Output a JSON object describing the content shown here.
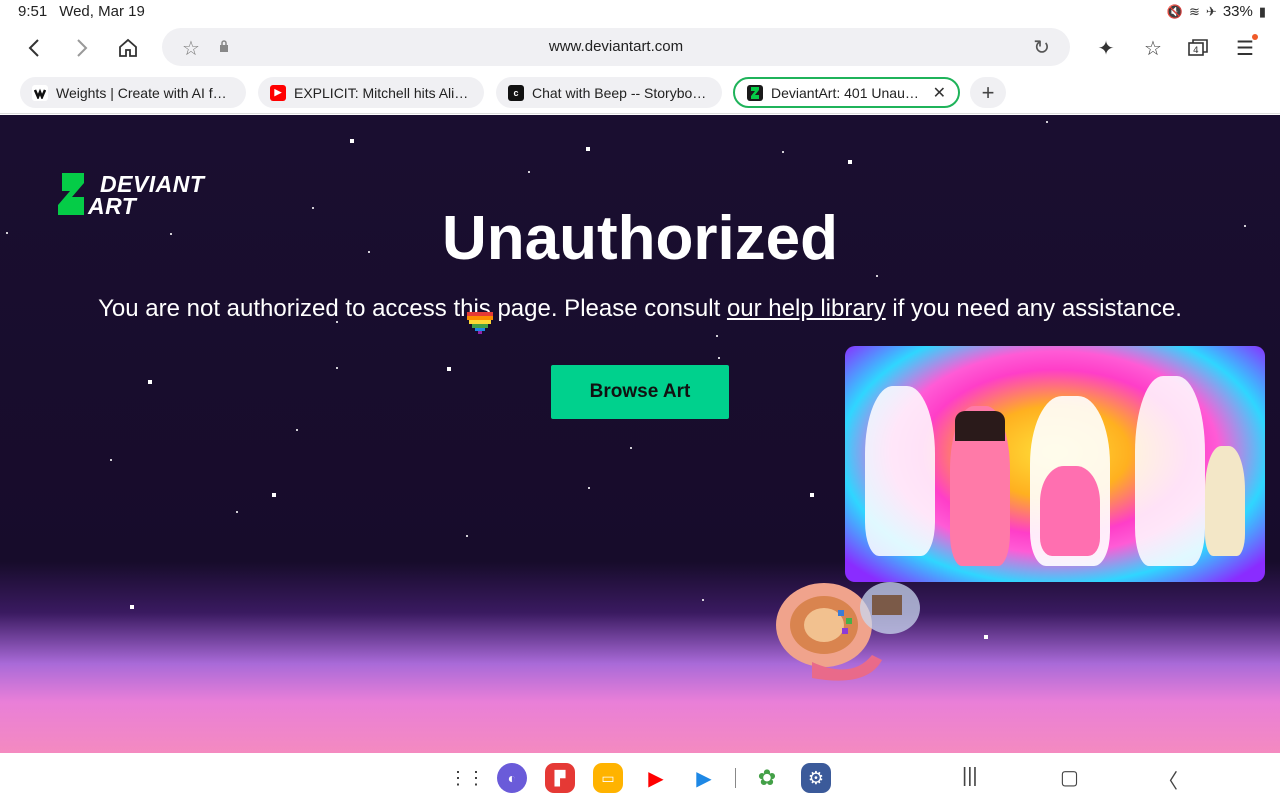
{
  "status": {
    "time": "9:51",
    "date": "Wed, Mar 19",
    "battery": "33%"
  },
  "browser": {
    "url": "www.deviantart.com",
    "tabs": [
      {
        "label": "Weights | Create with AI for ...",
        "favicon": "weights-icon",
        "color": "#111111"
      },
      {
        "label": "EXPLICIT: Mitchell hits Alici...",
        "favicon": "youtube-icon",
        "color": "#ff0000"
      },
      {
        "label": "Chat with Beep -- Storybots...",
        "favicon": "character-ai-icon",
        "color": "#111111"
      },
      {
        "label": "DeviantArt: 401 Unauth...",
        "favicon": "deviantart-icon",
        "color": "#05cc47",
        "active": true
      }
    ]
  },
  "page": {
    "logo_line1": "DEVIANT",
    "logo_line2": "ART",
    "title": "Unauthorized",
    "message_before": "You are not authorized to access this page. Please consult ",
    "help_link": "our help library",
    "message_after": " if you need any assistance.",
    "browse_button": "Browse Art",
    "accent_color": "#00d18d"
  },
  "dock": {
    "apps": [
      "app-drawer-icon",
      "samsung-internet-icon",
      "flipboard-icon",
      "my-files-icon",
      "youtube-icon",
      "play-store-icon",
      "google-photos-icon",
      "settings-icon"
    ]
  }
}
